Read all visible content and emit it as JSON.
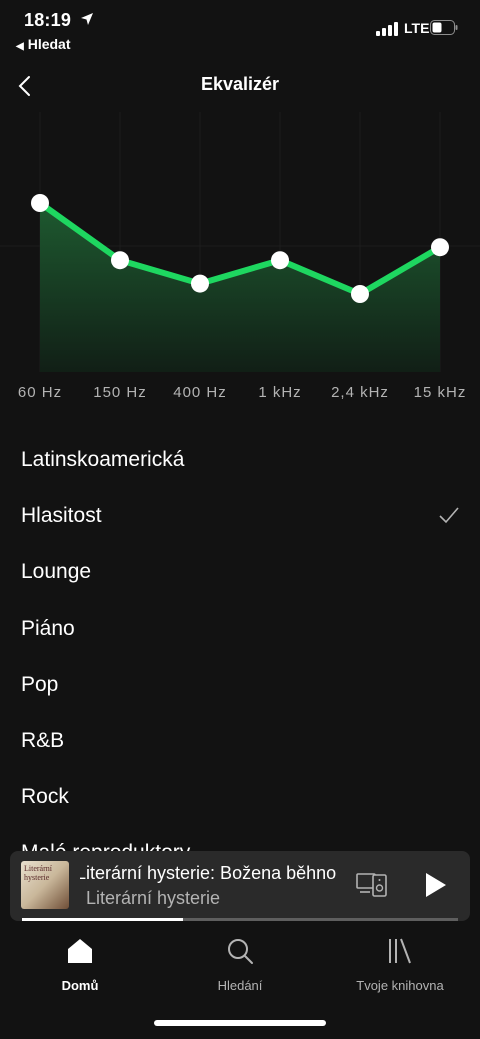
{
  "status_bar": {
    "time": "18:19",
    "back_app": "Hledat",
    "network": "LTE",
    "battery_level": 0.45
  },
  "header": {
    "title": "Ekvalizér",
    "back_icon": "chevron-left-icon"
  },
  "equalizer": {
    "bands": [
      {
        "label": "60 Hz",
        "level": 0.65
      },
      {
        "label": "150 Hz",
        "level": 0.43
      },
      {
        "label": "400 Hz",
        "level": 0.34
      },
      {
        "label": "1 kHz",
        "level": 0.43
      },
      {
        "label": "2,4 kHz",
        "level": 0.3
      },
      {
        "label": "15 kHz",
        "level": 0.48
      }
    ],
    "accent_color": "#1ed760"
  },
  "presets": [
    {
      "label": "Latinskoamerická",
      "selected": false
    },
    {
      "label": "Hlasitost",
      "selected": true
    },
    {
      "label": "Lounge",
      "selected": false
    },
    {
      "label": "Piáno",
      "selected": false
    },
    {
      "label": "Pop",
      "selected": false
    },
    {
      "label": "R&B",
      "selected": false
    },
    {
      "label": "Rock",
      "selected": false
    },
    {
      "label": "Malé reproduktory",
      "selected": false
    }
  ],
  "mini_player": {
    "cover_text": "Literární hysterie",
    "track_title": "Literární hysterie: Božena běhno",
    "artist": "Literární hysterie",
    "progress": 0.37,
    "devices_icon": "devices-icon",
    "play_icon": "play-icon"
  },
  "tabs": [
    {
      "label": "Domů",
      "icon": "home-icon",
      "active": true
    },
    {
      "label": "Hledání",
      "icon": "search-icon",
      "active": false
    },
    {
      "label": "Tvoje knihovna",
      "icon": "library-icon",
      "active": false
    }
  ]
}
